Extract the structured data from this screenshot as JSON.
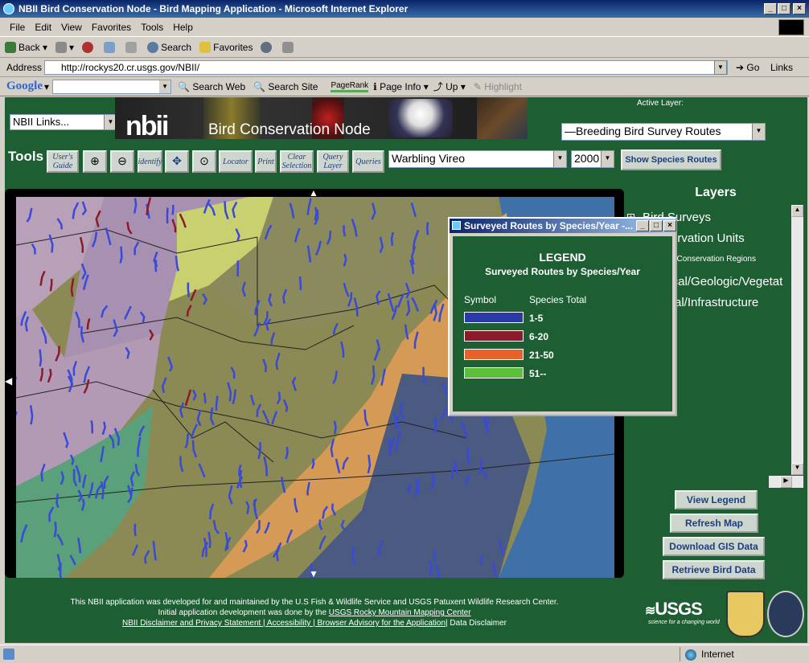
{
  "window": {
    "title": "NBII Bird Conservation Node - Bird Mapping Application - Microsoft Internet Explorer"
  },
  "menu": [
    "File",
    "Edit",
    "View",
    "Favorites",
    "Tools",
    "Help"
  ],
  "toolbar": {
    "back": "Back",
    "search": "Search",
    "favorites": "Favorites"
  },
  "address": {
    "label": "Address",
    "url": "http://rockys20.cr.usgs.gov/NBII/",
    "go": "Go",
    "links": "Links"
  },
  "google": {
    "logo": "Google",
    "search_web": "Search Web",
    "search_site": "Search Site",
    "pagerank": "PageRank",
    "page_info": "Page Info",
    "up": "Up",
    "highlight": "Highlight"
  },
  "app": {
    "nbii_links": "NBII Links...",
    "logo": "nbii",
    "node_name": "Bird Conservation Node",
    "active_layer_label": "Active Layer:",
    "active_layer": "—Breeding Bird Survey Routes",
    "tools_label": "Tools",
    "tools": [
      "User's Guide",
      "",
      "",
      "identify",
      "",
      "",
      "Locator",
      "Print",
      "Clear Selection",
      "Query Layer",
      "Queries"
    ],
    "species": "Warbling Vireo",
    "year": "2000",
    "show_routes": "Show Species Routes"
  },
  "layers": {
    "title": "Layers",
    "items": [
      {
        "label": "Bird Surveys",
        "icon": "+"
      },
      {
        "label": "Conservation Units",
        "icon": "−"
      },
      {
        "label": "Bird Conservation Regions",
        "checked": true
      },
      {
        "label": "Physical/Geologic/Vegetat",
        "icon": "+"
      },
      {
        "label": "Political/Infrastructure",
        "icon": "+"
      }
    ]
  },
  "buttons": {
    "view_legend": "View Legend",
    "refresh": "Refresh Map",
    "download": "Download GIS Data",
    "retrieve": "Retrieve Bird Data"
  },
  "legend": {
    "window_title": "Surveyed Routes by Species/Year -...",
    "heading": "LEGEND",
    "subheading": "Surveyed Routes by Species/Year",
    "col_symbol": "Symbol",
    "col_total": "Species Total",
    "rows": [
      {
        "label": "1-5",
        "color": "#2a3aa8"
      },
      {
        "label": "6-20",
        "color": "#8b1a2a"
      },
      {
        "label": "21-50",
        "color": "#e8602a"
      },
      {
        "label": "51--",
        "color": "#5cbf3a"
      }
    ]
  },
  "footer": {
    "line1": "This NBII application was developed for and maintained by the U.S Fish & Wildlife Service and USGS Patuxent Wildlife Research Center.",
    "line2a": "Initial application development was done by the ",
    "line2b": "USGS Rocky Mountain Mapping Center",
    "line3a": "NBII Disclaimer and Privacy Statement | Accessibility | Browser Advisory for the Application",
    "line3b": "| Data Disclaimer"
  },
  "logos": {
    "usgs": "USGS",
    "usgs_tag": "science for a changing world"
  },
  "status": {
    "zone": "Internet"
  }
}
